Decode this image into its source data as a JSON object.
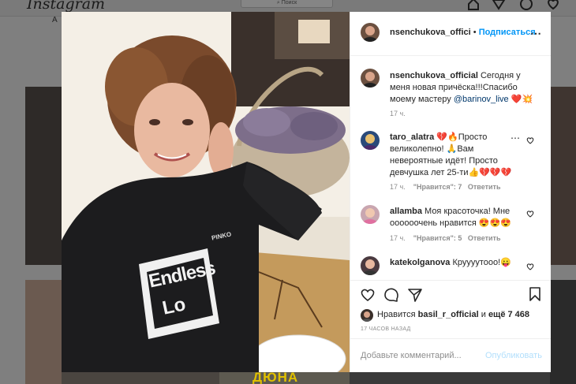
{
  "background": {
    "logo": "Instagram",
    "search_placeholder": "Поиск",
    "side_label": "A"
  },
  "post": {
    "username": "nsenchukova_offici",
    "follow_label": "Подписаться",
    "more_icon": "more-horizontal-icon",
    "caption": {
      "username": "nsenchukova_official",
      "text": "Сегодня у меня новая причёска!!!Спасибо моему мастеру",
      "mention": "@barinov_live",
      "emoji": "❤️💥",
      "time": "17 ч."
    },
    "comments": [
      {
        "username": "taro_alatra",
        "text": "💔🔥Просто великолепно! 🙏Вам невероятные идёт! Просто девчушка лет 25-ти👍💔💔💔",
        "time": "17 ч.",
        "likes": "\"Нравится\": 7",
        "reply": "Ответить"
      },
      {
        "username": "allamba",
        "text": "Моя красоточка! Мне оооооочень нравится 😍😍😍",
        "time": "17 ч.",
        "likes": "\"Нравится\": 5",
        "reply": "Ответить"
      },
      {
        "username": "katekolganova",
        "text": "Круууутооо!😛"
      }
    ],
    "liked_by_prefix": "Нравится",
    "liked_by_user": "basil_r_official",
    "liked_by_and": "и",
    "liked_by_more": "ещё 7 468",
    "posted_time": "17 ЧАСОВ НАЗАД",
    "comment_placeholder": "Добавьте комментарий...",
    "publish_label": "Опубликовать",
    "photo_text": {
      "shirt_brand": "PINKO",
      "shirt_line1": "Endless",
      "shirt_line2": "Lo",
      "dune": "ДЮНА"
    }
  },
  "colors": {
    "accent": "#0095f6",
    "link": "#00376b",
    "heart": "#ed4956"
  }
}
